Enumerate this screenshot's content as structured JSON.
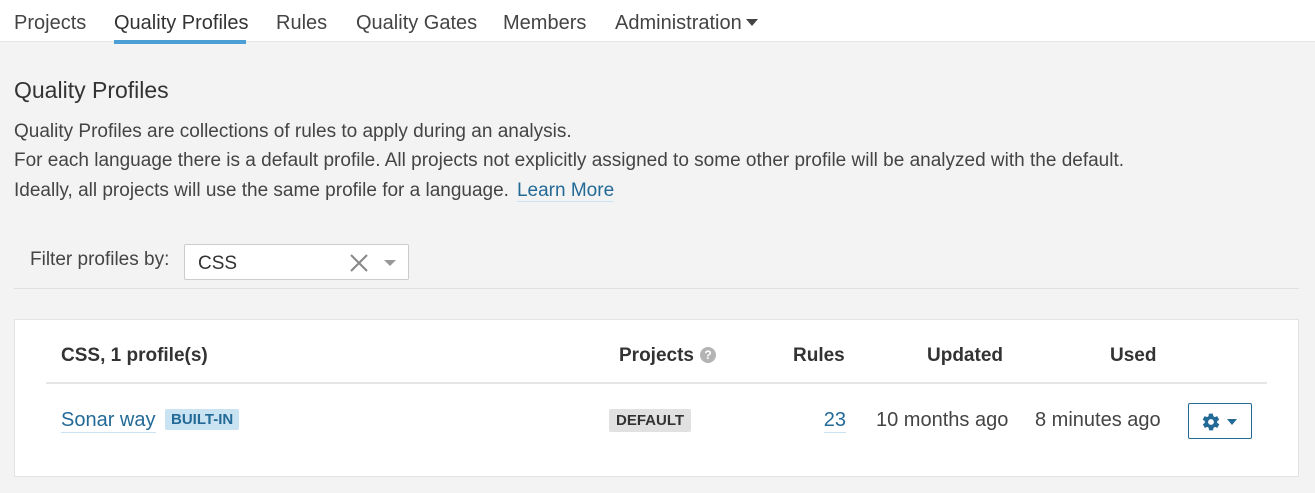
{
  "nav": {
    "items": [
      {
        "label": "Projects"
      },
      {
        "label": "Quality Profiles",
        "active": true
      },
      {
        "label": "Rules"
      },
      {
        "label": "Quality Gates"
      },
      {
        "label": "Members"
      },
      {
        "label": "Administration",
        "has_dropdown": true
      }
    ],
    "active_color": "#4b9fd5"
  },
  "header": {
    "title": "Quality Profiles",
    "description": [
      "Quality Profiles are collections of rules to apply during an analysis.",
      "For each language there is a default profile. All projects not explicitly assigned to some other profile will be analyzed with the default.",
      "Ideally, all projects will use the same profile for a language."
    ],
    "learn_more": "Learn More"
  },
  "filter": {
    "label": "Filter profiles by:",
    "value": "CSS",
    "icons": [
      "clear-icon",
      "chevron-down-icon"
    ]
  },
  "table": {
    "columns": {
      "language": "CSS, 1 profile(s)",
      "projects": "Projects",
      "rules": "Rules",
      "updated": "Updated",
      "used": "Used"
    },
    "rows": [
      {
        "name": "Sonar way",
        "built_in_badge": "BUILT-IN",
        "projects_badge": "DEFAULT",
        "rules": "23",
        "updated": "10 months ago",
        "used": "8 minutes ago",
        "actions_icon": "gear-icon"
      }
    ]
  },
  "colors": {
    "link": "#236a97",
    "badge_blue_bg": "#cae3f2",
    "badge_gray_bg": "#e1e1e1",
    "page_bg": "#f3f3f3"
  }
}
